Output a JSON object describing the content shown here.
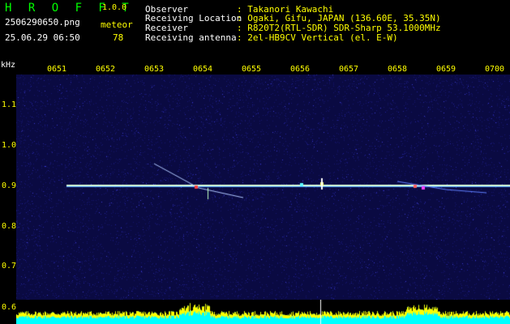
{
  "header": {
    "title": "H R O F F T",
    "version": "1.0.0",
    "filename": "2506290650.png",
    "datetime": "25.06.29 06:50",
    "meteor_label": "meteor",
    "meteor_count": "78"
  },
  "info": {
    "rows": [
      {
        "label": "Observer",
        "value": ": Takanori Kawachi"
      },
      {
        "label": "Receiving Location",
        "value": ": Ogaki, Gifu, JAPAN (136.60E, 35.35N)"
      },
      {
        "label": "Receiver",
        "value": ": R820T2(RTL-SDR) SDR-Sharp 53.1000MHz"
      },
      {
        "label": "Receiving antenna",
        "value": ": 2el-HB9CV Vertical (el. E-W)"
      }
    ]
  },
  "axes": {
    "unit": "kHz",
    "time_ticks": [
      "0651",
      "0652",
      "0653",
      "0654",
      "0655",
      "0656",
      "0657",
      "0658",
      "0659",
      "0700"
    ],
    "freq_ticks": [
      "1.1",
      "1.0",
      "0.9",
      "0.8",
      "0.7",
      "0.6"
    ]
  },
  "colors": {
    "background": "#000000",
    "plot_background": "#0a0a42",
    "carrier": "#d8ffd8",
    "band_fill": "#00ffff",
    "band_peak": "#ffff00",
    "label_yellow": "#ffff00",
    "label_green": "#00ff00"
  }
}
